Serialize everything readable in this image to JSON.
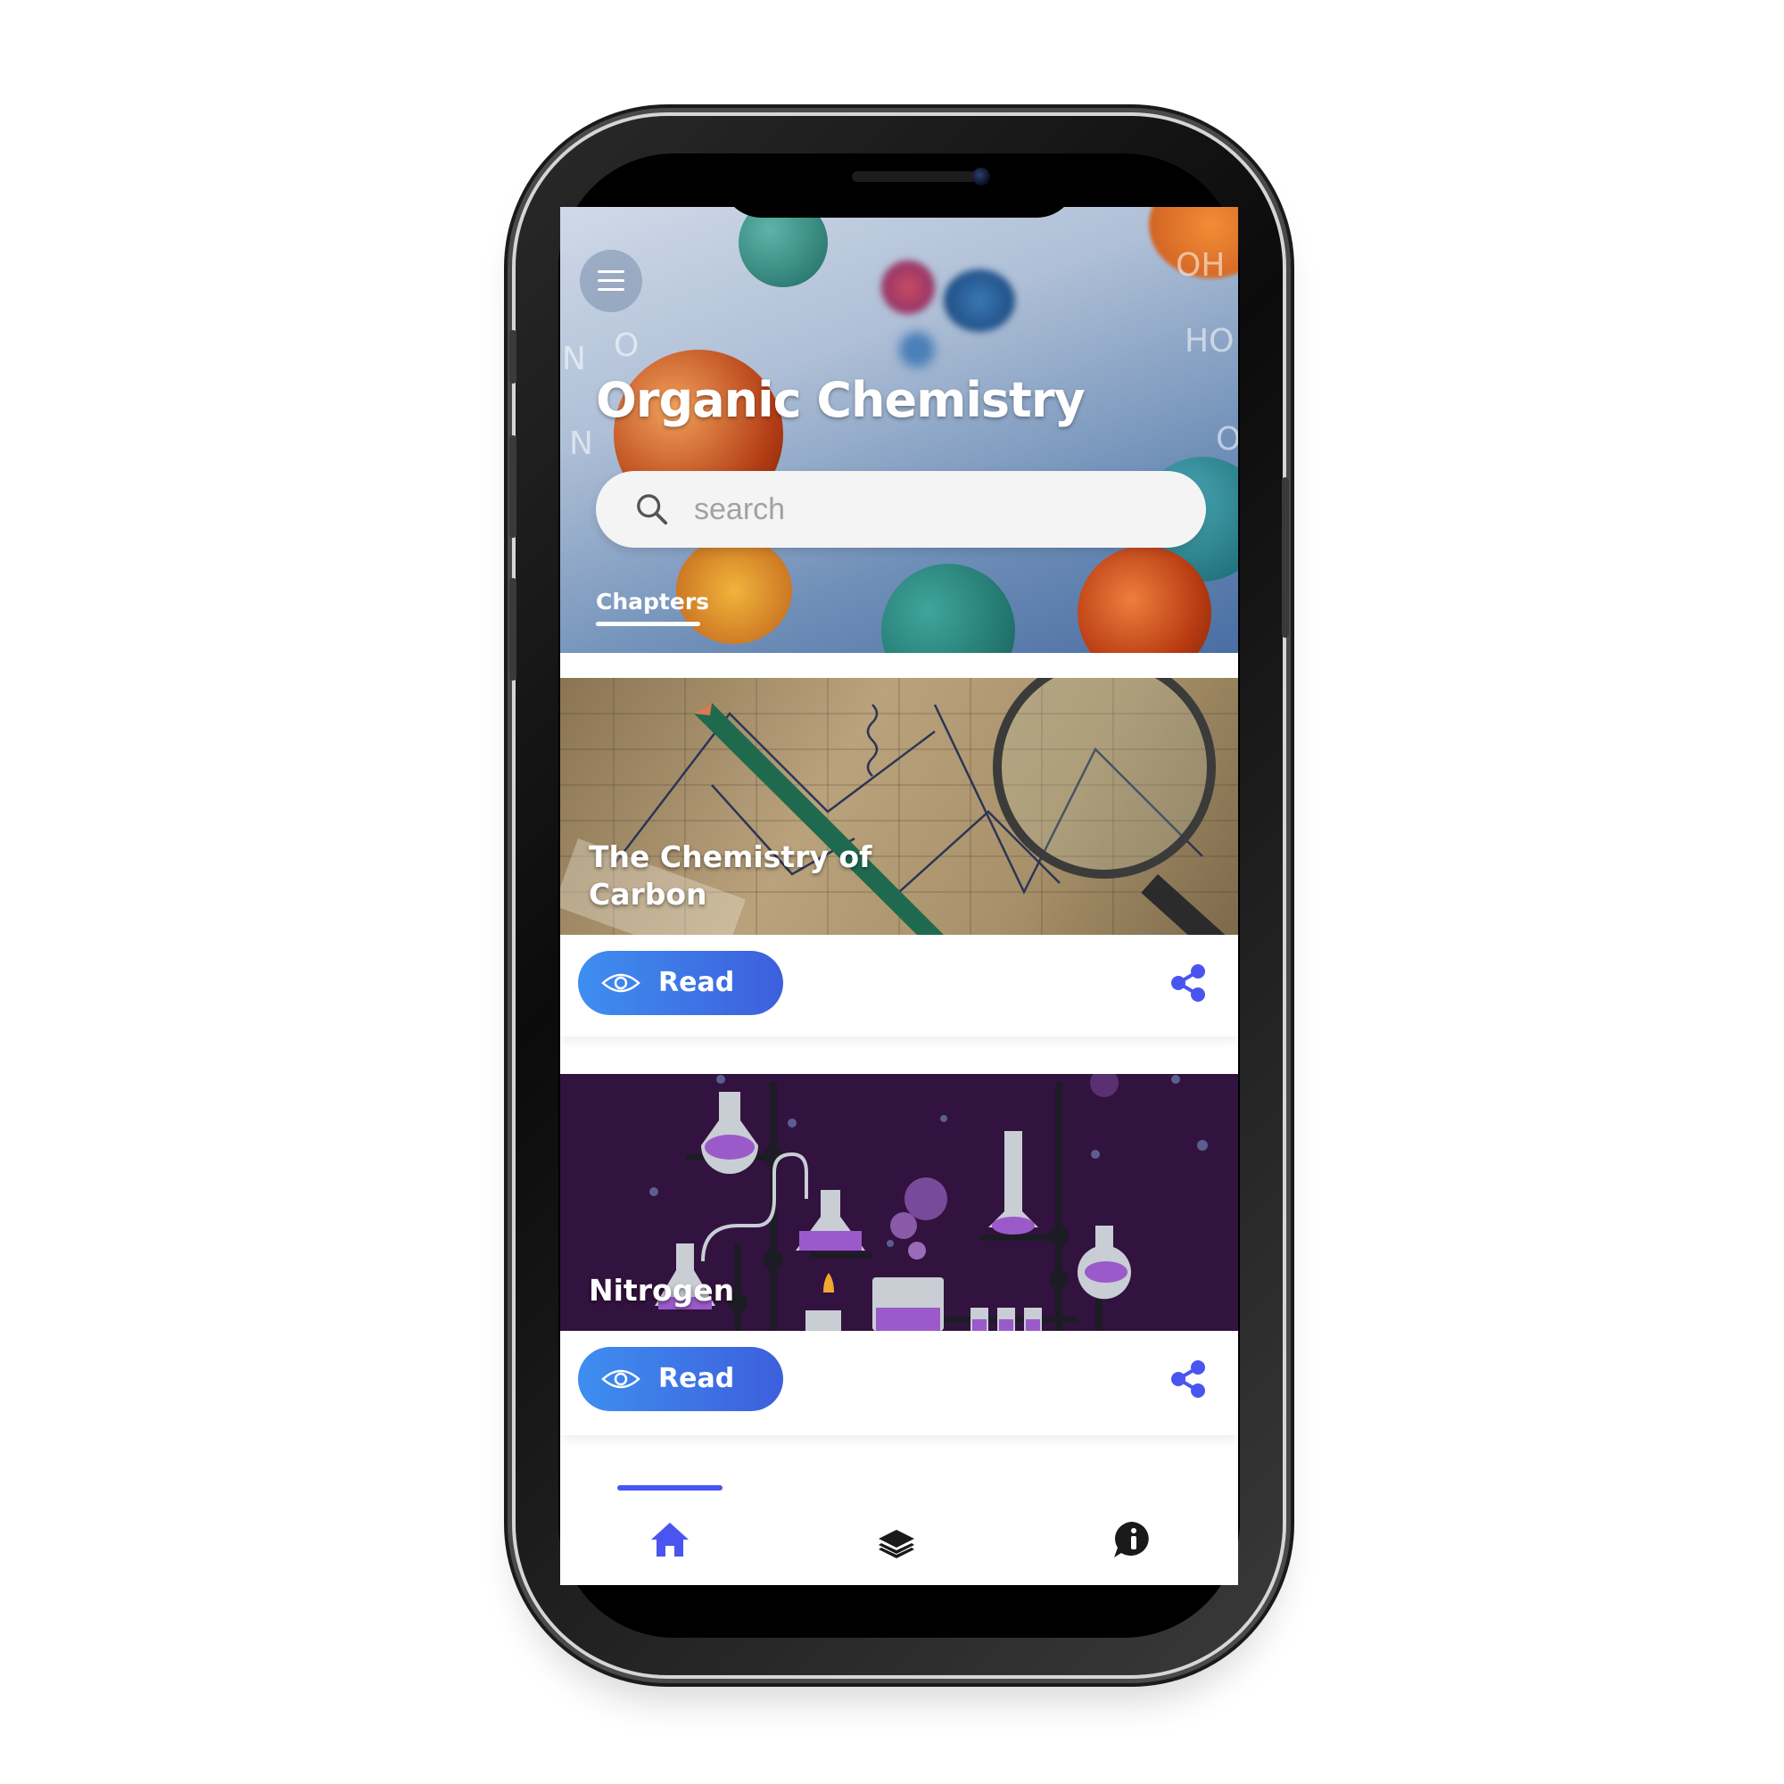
{
  "header": {
    "title": "Organic Chemistry",
    "menu_icon": "menu-icon",
    "search": {
      "placeholder": "search",
      "value": ""
    },
    "tabs": [
      {
        "label": "Chapters",
        "active": true
      }
    ]
  },
  "chapters": [
    {
      "title": "The Chemistry of Carbon",
      "read_label": "Read",
      "image_theme": "sketch-paper"
    },
    {
      "title": "Nitrogen",
      "read_label": "Read",
      "image_theme": "lab-flasks-purple"
    }
  ],
  "bottom_nav": {
    "items": [
      {
        "icon": "home-icon",
        "active": true
      },
      {
        "icon": "layers-icon",
        "active": false
      },
      {
        "icon": "info-chat-icon",
        "active": false
      }
    ]
  },
  "colors": {
    "accent": "#4a55f0",
    "button_start": "#3e8ef0",
    "button_end": "#3d5fdc",
    "nitrogen_bg": "#32123f",
    "icon_dark": "#1a1a1a"
  }
}
